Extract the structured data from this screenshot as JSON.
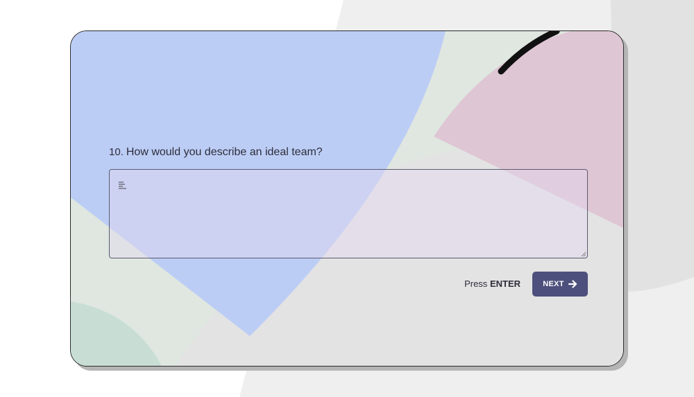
{
  "question": {
    "number": "10.",
    "text": "How would you describe an ideal team?"
  },
  "answer": {
    "value": "",
    "icon": "text-align-icon"
  },
  "submit": {
    "press_label": "Press",
    "key_label": "ENTER",
    "next_label": "NEXT",
    "next_icon": "arrow-right-icon"
  },
  "colors": {
    "card_background": "#dfe7e0",
    "blue_shape": "#bccdf5",
    "pink_shape": "#dfc6d4",
    "next_button": "#4d4f7c"
  }
}
